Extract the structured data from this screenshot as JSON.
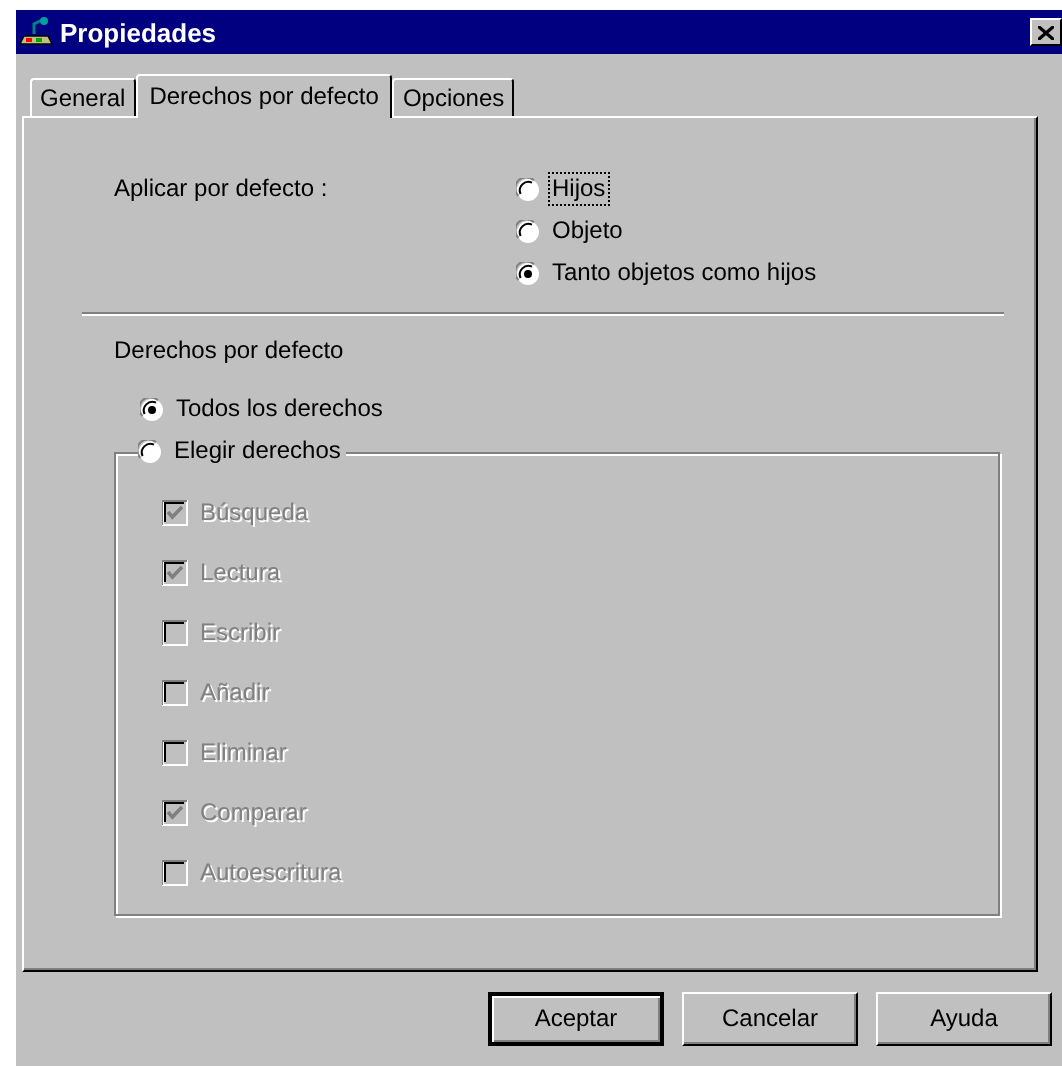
{
  "window": {
    "title": "Propiedades"
  },
  "tabs": [
    {
      "label": "General",
      "selected": false
    },
    {
      "label": "Derechos por defecto",
      "selected": true
    },
    {
      "label": "Opciones",
      "selected": false
    }
  ],
  "apply": {
    "label": "Aplicar por defecto :",
    "options": [
      {
        "label": "Hijos",
        "selected": false,
        "focused": true
      },
      {
        "label": "Objeto",
        "selected": false,
        "focused": false
      },
      {
        "label": "Tanto objetos como hijos",
        "selected": true,
        "focused": false
      }
    ]
  },
  "rights": {
    "heading": "Derechos por defecto",
    "all": {
      "label": "Todos los derechos",
      "selected": true
    },
    "choose": {
      "label": "Elegir derechos",
      "selected": false
    },
    "checkboxes": [
      {
        "label": "Búsqueda",
        "checked": true,
        "disabled": true
      },
      {
        "label": "Lectura",
        "checked": true,
        "disabled": true
      },
      {
        "label": "Escribir",
        "checked": false,
        "disabled": true
      },
      {
        "label": "Añadir",
        "checked": false,
        "disabled": true
      },
      {
        "label": "Eliminar",
        "checked": false,
        "disabled": true
      },
      {
        "label": "Comparar",
        "checked": true,
        "disabled": true
      },
      {
        "label": "Autoescritura",
        "checked": false,
        "disabled": true
      }
    ]
  },
  "buttons": [
    {
      "label": "Aceptar",
      "default": true
    },
    {
      "label": "Cancelar",
      "default": false
    },
    {
      "label": "Ayuda",
      "default": false
    }
  ]
}
